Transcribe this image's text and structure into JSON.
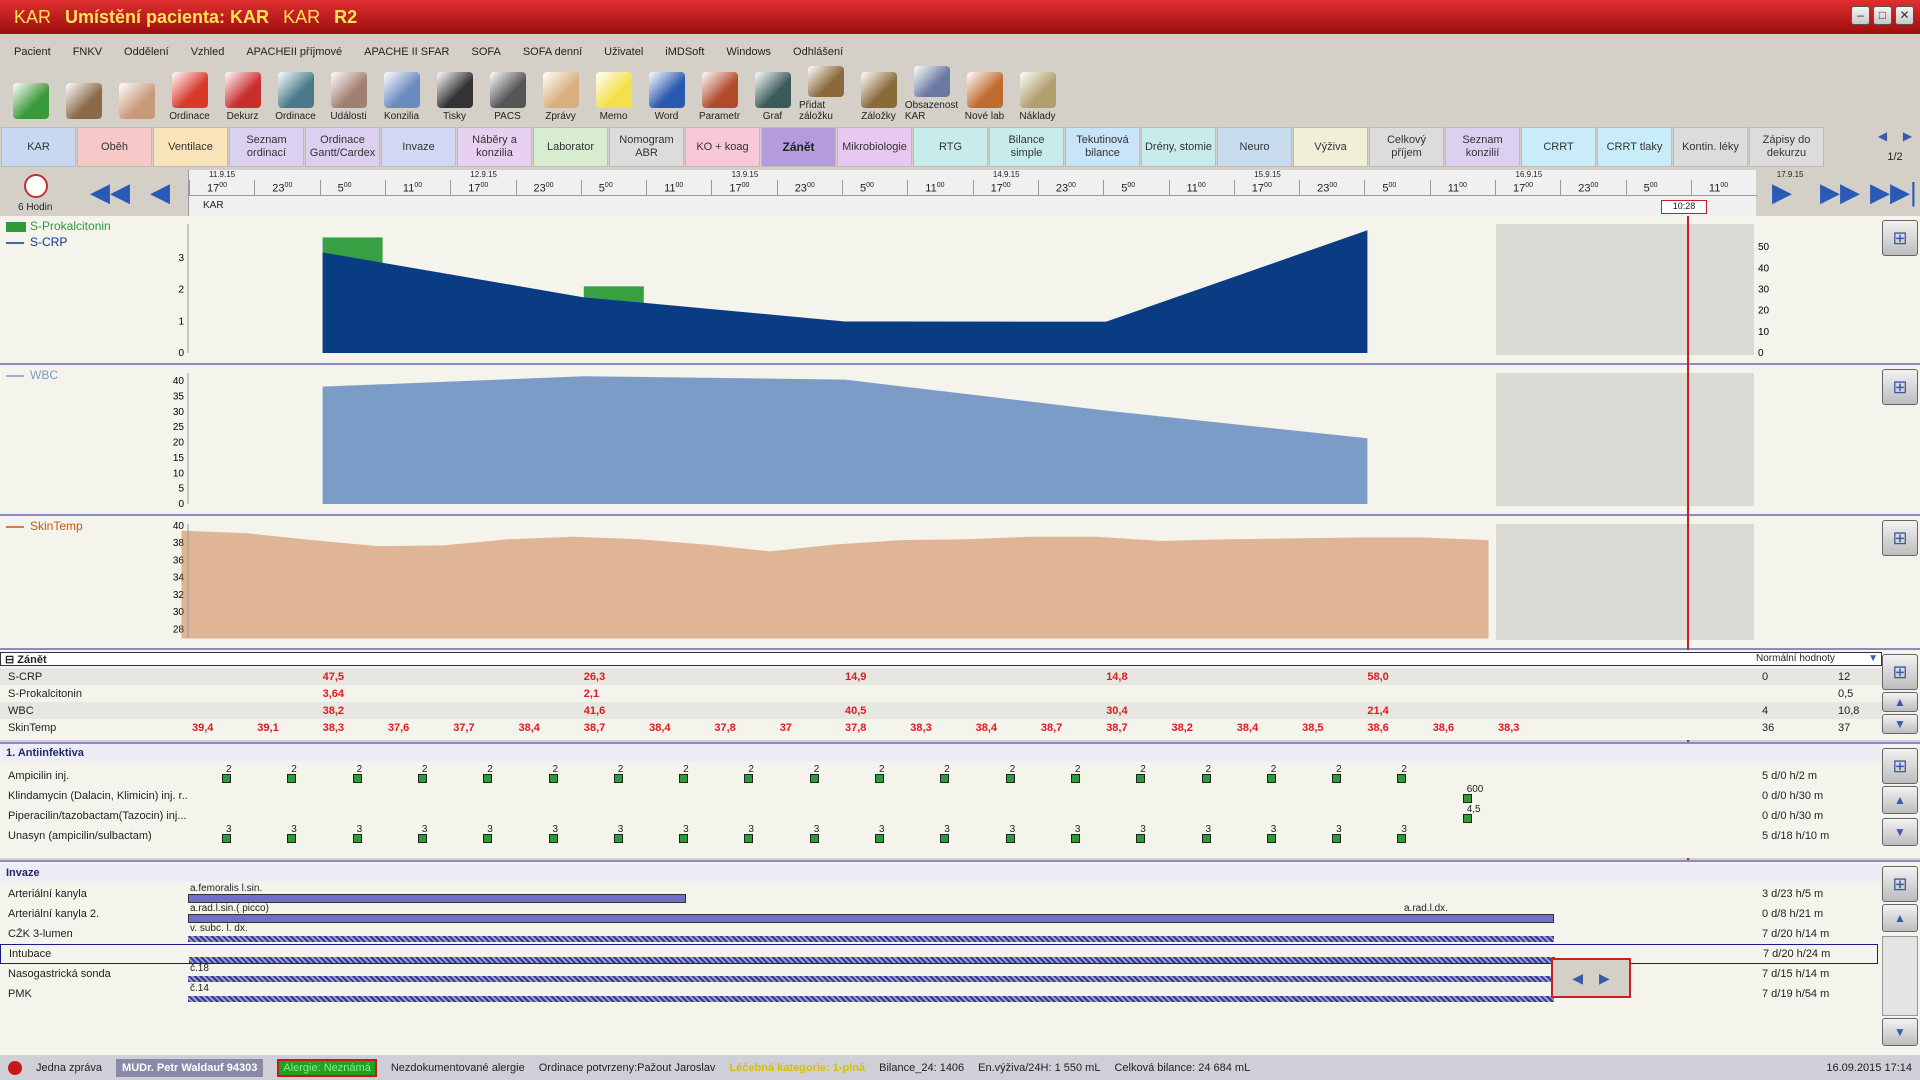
{
  "window": {
    "title_a": "KAR",
    "title_b": "Umístění pacienta: KAR",
    "title_c": "KAR",
    "title_d": "R2"
  },
  "menu": [
    "Pacient",
    "FNKV",
    "Oddělení",
    "Vzhled",
    "APACHEII příjmové",
    "APACHE II SFAR",
    "SOFA",
    "SOFA denní",
    "Uživatel",
    "iMDSoft",
    "Windows",
    "Odhlášení"
  ],
  "toolbar": [
    {
      "label": "",
      "icon": "refresh-icon",
      "color": "#3a9a3a"
    },
    {
      "label": "",
      "icon": "doctor-avatar-icon",
      "color": "#8a6a4a"
    },
    {
      "label": "",
      "icon": "nurse-avatar-icon",
      "color": "#c89a7a"
    },
    {
      "label": "Ordinace",
      "icon": "alarm-clock-icon",
      "color": "#d83a2a"
    },
    {
      "label": "Dekurz",
      "icon": "books-icon",
      "color": "#c83030"
    },
    {
      "label": "Ordinace",
      "icon": "database-icon",
      "color": "#4a7a8a"
    },
    {
      "label": "Události",
      "icon": "person-icon",
      "color": "#a08070"
    },
    {
      "label": "Konzilia",
      "icon": "surgeon-icon",
      "color": "#6a8ac0"
    },
    {
      "label": "Tisky",
      "icon": "printer-icon",
      "color": "#333333"
    },
    {
      "label": "PACS",
      "icon": "xray-icon",
      "color": "#555555"
    },
    {
      "label": "Zprávy",
      "icon": "envelope-icon",
      "color": "#d8b080"
    },
    {
      "label": "Memo",
      "icon": "sticky-note-icon",
      "color": "#f4e04a"
    },
    {
      "label": "Word",
      "icon": "word-icon",
      "color": "#2a5ab0"
    },
    {
      "label": "Parametr",
      "icon": "binoculars-icon",
      "color": "#b04a2a"
    },
    {
      "label": "Graf",
      "icon": "chart-icon",
      "color": "#3a5a5a"
    },
    {
      "label": "Přidat záložku",
      "icon": "add-bookmark-icon",
      "color": "#8a6a3a"
    },
    {
      "label": "Záložky",
      "icon": "bookmarks-icon",
      "color": "#8a6a3a"
    },
    {
      "label": "Obsazenost KAR",
      "icon": "bed-icon",
      "color": "#6a7aa0"
    },
    {
      "label": "Nové lab",
      "icon": "lab-icon",
      "color": "#c06a30"
    },
    {
      "label": "Náklady",
      "icon": "money-bag-icon",
      "color": "#b0a070"
    }
  ],
  "tabs": [
    {
      "label": "KAR",
      "color": "#c8d8f0"
    },
    {
      "label": "Oběh",
      "color": "#f6c8c8"
    },
    {
      "label": "Ventilace",
      "color": "#f8e4b8"
    },
    {
      "label": "Seznam ordinací",
      "color": "#dcd0f0"
    },
    {
      "label": "Ordinace Gantt/Cardex",
      "color": "#dcd0f0"
    },
    {
      "label": "Invaze",
      "color": "#d0d8f4"
    },
    {
      "label": "Náběry a konzilia",
      "color": "#e8d0f0"
    },
    {
      "label": "Laborator",
      "color": "#d8ecd0"
    },
    {
      "label": "Nomogram ABR",
      "color": "#dcdcdc"
    },
    {
      "label": "KO + koag",
      "color": "#f8c8d8"
    },
    {
      "label": "Zánět",
      "color": "#b49cdc"
    },
    {
      "label": "Mikrobiologie",
      "color": "#e8c8f0"
    },
    {
      "label": "RTG",
      "color": "#c8ecec"
    },
    {
      "label": "Bilance simple",
      "color": "#c8ecec"
    },
    {
      "label": "Tekutinová bilance",
      "color": "#c8e4f8"
    },
    {
      "label": "Drény, stomie",
      "color": "#c8ecec"
    },
    {
      "label": "Neuro",
      "color": "#c8dcf0"
    },
    {
      "label": "Výživa",
      "color": "#f0f0d8"
    },
    {
      "label": "Celkový příjem",
      "color": "#dcdcdc"
    },
    {
      "label": "Seznam konzilií",
      "color": "#dcd0f0"
    },
    {
      "label": "CRRT",
      "color": "#c8ecf8"
    },
    {
      "label": "CRRT tlaky",
      "color": "#c8ecf8"
    },
    {
      "label": "Kontin. léky",
      "color": "#dcdcdc"
    },
    {
      "label": "Zápisy do dekurzu",
      "color": "#dcdcdc"
    }
  ],
  "tab_page": "1/2",
  "timeline": {
    "interval": "6 Hodin",
    "dates": [
      "11.9.15",
      "12.9.15",
      "13.9.15",
      "14.9.15",
      "15.9.15",
      "16.9.15",
      "17.9.15"
    ],
    "hours": [
      "17",
      "23",
      "5",
      "11",
      "17",
      "23",
      "5",
      "11",
      "17",
      "23",
      "5",
      "11",
      "17",
      "23",
      "5",
      "11",
      "17",
      "23",
      "5",
      "11",
      "17",
      "23",
      "5",
      "11"
    ],
    "minutes_sup": "00",
    "ward": "KAR",
    "current_marker": "10:28"
  },
  "chart_data": [
    {
      "type": "area",
      "title": "S-CRP / S-Prokalcitonin",
      "series": [
        {
          "name": "S-Prokalcitonin",
          "kind": "bar",
          "color": "#2e9a3a",
          "points": [
            [
              2,
              3.64
            ],
            [
              6,
              2.1
            ]
          ]
        },
        {
          "name": "S-CRP",
          "kind": "area",
          "color": "#0a3c84",
          "points": [
            [
              2,
              47.5
            ],
            [
              6,
              26.3
            ],
            [
              10,
              14.9
            ],
            [
              14,
              14.8
            ],
            [
              18,
              58.0
            ]
          ]
        }
      ],
      "y_left": {
        "ticks": [
          0,
          1,
          2,
          3
        ],
        "range": [
          0,
          4
        ]
      },
      "y_right": {
        "ticks": [
          0,
          10,
          20,
          30,
          40,
          50
        ],
        "range": [
          0,
          60
        ]
      }
    },
    {
      "type": "area",
      "title": "WBC",
      "series": [
        {
          "name": "WBC",
          "color": "#7c9cc8",
          "points": [
            [
              2,
              38.2
            ],
            [
              6,
              41.6
            ],
            [
              10,
              40.5
            ],
            [
              14,
              30.4
            ],
            [
              18,
              21.4
            ]
          ]
        }
      ],
      "y_left": {
        "ticks": [
          0,
          5,
          10,
          15,
          20,
          25,
          30,
          35,
          40
        ],
        "range": [
          0,
          42
        ]
      }
    },
    {
      "type": "area",
      "title": "SkinTemp",
      "series": [
        {
          "name": "SkinTemp",
          "color": "#c05a14",
          "points": [
            [
              0,
              39.4
            ],
            [
              1,
              39.1
            ],
            [
              2,
              38.3
            ],
            [
              3,
              37.6
            ],
            [
              4,
              37.7
            ],
            [
              5,
              38.4
            ],
            [
              6,
              38.7
            ],
            [
              7,
              38.4
            ],
            [
              8,
              37.8
            ],
            [
              9,
              37
            ],
            [
              10,
              37.8
            ],
            [
              11,
              38.3
            ],
            [
              12,
              38.4
            ],
            [
              13,
              38.7
            ],
            [
              14,
              38.7
            ],
            [
              15,
              38.2
            ],
            [
              16,
              38.4
            ],
            [
              17,
              38.5
            ],
            [
              18,
              38.6
            ],
            [
              19,
              38.6
            ],
            [
              20,
              38.3
            ]
          ]
        }
      ],
      "y_left": {
        "ticks": [
          28,
          30,
          32,
          34,
          36,
          38,
          40
        ],
        "range": [
          27,
          40
        ]
      }
    }
  ],
  "zanet": {
    "header": "Zánět",
    "normal_header": "Normální hodnoty",
    "rows": [
      {
        "label": "S-CRP",
        "values": [
          {
            "col": 2,
            "v": "47,5"
          },
          {
            "col": 6,
            "v": "26,3"
          },
          {
            "col": 10,
            "v": "14,9"
          },
          {
            "col": 14,
            "v": "14,8"
          },
          {
            "col": 18,
            "v": "58,0"
          }
        ],
        "norm_lo": "0",
        "norm_hi": "12"
      },
      {
        "label": "S-Prokalcitonin",
        "values": [
          {
            "col": 2,
            "v": "3,64"
          },
          {
            "col": 6,
            "v": "2,1"
          }
        ],
        "norm_lo": "",
        "norm_hi": "0,5"
      },
      {
        "label": "WBC",
        "values": [
          {
            "col": 2,
            "v": "38,2"
          },
          {
            "col": 6,
            "v": "41,6"
          },
          {
            "col": 10,
            "v": "40,5"
          },
          {
            "col": 14,
            "v": "30,4"
          },
          {
            "col": 18,
            "v": "21,4"
          }
        ],
        "norm_lo": "4",
        "norm_hi": "10,8"
      },
      {
        "label": "SkinTemp",
        "values": [
          {
            "col": 0,
            "v": "39,4"
          },
          {
            "col": 1,
            "v": "39,1"
          },
          {
            "col": 2,
            "v": "38,3"
          },
          {
            "col": 3,
            "v": "37,6"
          },
          {
            "col": 4,
            "v": "37,7"
          },
          {
            "col": 5,
            "v": "38,4"
          },
          {
            "col": 6,
            "v": "38,7"
          },
          {
            "col": 7,
            "v": "38,4"
          },
          {
            "col": 8,
            "v": "37,8"
          },
          {
            "col": 9,
            "v": "37"
          },
          {
            "col": 10,
            "v": "37,8"
          },
          {
            "col": 11,
            "v": "38,3"
          },
          {
            "col": 12,
            "v": "38,4"
          },
          {
            "col": 13,
            "v": "38,7"
          },
          {
            "col": 14,
            "v": "38,7"
          },
          {
            "col": 15,
            "v": "38,2"
          },
          {
            "col": 16,
            "v": "38,4"
          },
          {
            "col": 17,
            "v": "38,5"
          },
          {
            "col": 18,
            "v": "38,6"
          },
          {
            "col": 19,
            "v": "38,6"
          },
          {
            "col": 20,
            "v": "38,3"
          }
        ],
        "norm_lo": "36",
        "norm_hi": "37"
      }
    ]
  },
  "antiinfektiva": {
    "header": "1. Antiinfektiva",
    "rows": [
      {
        "label": "Ampicilin inj.",
        "dose": "2",
        "cols": [
          0,
          1,
          2,
          3,
          4,
          5,
          6,
          7,
          8,
          9,
          10,
          11,
          12,
          13,
          14,
          15,
          16,
          17,
          18
        ],
        "duration": "5 d/0 h/2 m"
      },
      {
        "label": "Klindamycin (Dalacin, Klimicin) inj. r...",
        "dose": "600",
        "cols": [
          19
        ],
        "duration": "0 d/0 h/30 m"
      },
      {
        "label": "Piperacilin/tazobactam(Tazocin) inj...",
        "dose": "4,5",
        "cols": [
          19
        ],
        "duration": "0 d/0 h/30 m"
      },
      {
        "label": "Unasyn (ampicilin/sulbactam)",
        "dose": "3",
        "cols": [
          0,
          1,
          2,
          3,
          4,
          5,
          6,
          7,
          8,
          9,
          10,
          11,
          12,
          13,
          14,
          15,
          16,
          17,
          18
        ],
        "duration": "5 d/18 h/10 m"
      }
    ]
  },
  "invaze": {
    "header": "Invaze",
    "rows": [
      {
        "label": "Arteriální kanyla",
        "detail": "a.femoralis l.sin.",
        "start": 0,
        "end": 6.7,
        "duration": "3 d/23 h/5 m"
      },
      {
        "label": "Arteriální kanyla 2.",
        "detail": "a.rad.l.sin.( picco)",
        "detail2": "a.rad.l.dx.",
        "start": 0,
        "end": 20,
        "duration": "0 d/8 h/21 m"
      },
      {
        "label": "CŽK 3-lumen",
        "detail": "v. subc. l. dx.",
        "start": 0,
        "end": 20,
        "duration": "7 d/20 h/14 m"
      },
      {
        "label": "Intubace",
        "detail": "",
        "start": 0,
        "end": 20,
        "duration": "7 d/20 h/24 m"
      },
      {
        "label": "Nasogastrická sonda",
        "detail": "č.18",
        "start": 0,
        "end": 20,
        "duration": "7 d/15 h/14 m"
      },
      {
        "label": "PMK",
        "detail": "č.14",
        "start": 0,
        "end": 20,
        "duration": "7 d/19 h/54 m"
      }
    ]
  },
  "status": {
    "message": "Jedna zpráva",
    "doctor": "MUDr. Petr Waldauf",
    "code": "94303",
    "allergy": "Alergie: Neznámá",
    "allergy_note": "Nezdokumentované alergie",
    "ordinace": "Ordinace potvrzeny:Pažout Jaroslav",
    "category": "Léčebná kategorie: 1-plná",
    "bilance": "Bilance_24: 1406",
    "vyziva": "En.výživa/24H: 1 550 mL",
    "celkova": "Celková bilance: 24 684 mL",
    "datetime": "16.09.2015 17:14"
  }
}
